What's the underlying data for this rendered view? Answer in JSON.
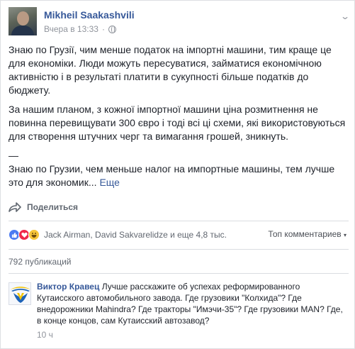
{
  "post": {
    "author": "Mikheil Saakashvili",
    "timestamp": "Вчера в 13:33",
    "separator": "·",
    "paragraphs": [
      "Знаю по Грузії, чим менше податок на імпортні машини, тим краще це для економіки. Люди можуть пересуватися, займатися економічною активністю і в результаті платити в сукупності більше податків до бюджету.",
      "За нашим планом, з кожної імпортної машини ціна розмитнення не повинна перевищувати 300 євро і тоді всі ці схеми, які використовуються для створення штучних черг та вимагання грошей, зникнуть.",
      "—",
      "Знаю по Грузии, чем меньше налог на импортные машины, тем лучше это для экономик..."
    ],
    "more_label": "Еще"
  },
  "actions": {
    "share_label": "Поделиться"
  },
  "reactions": {
    "summary": "Jack Airman, David Sakvarelidze и еще 4,8 тыс.",
    "top_comments_label": "Топ комментариев"
  },
  "shares": {
    "count_label": "792 публикаций"
  },
  "comment": {
    "author": "Виктор Кравец",
    "text": "Лучше расскажите об успехах реформированного Кутаисского автомобильного завода. Где грузовики \"Колхида\"? Где внедорожники Mahindra? Где тракторы \"Имэчи-35\"? Где грузовики MAN? Где, в конце концов, сам Кутаисский автозавод?",
    "time": "10 ч"
  },
  "colors": {
    "link": "#365899",
    "like": "#4b7bf1",
    "love": "#f0284a",
    "haha": "#f7c53a"
  },
  "icons": {
    "privacy": "globe-icon",
    "options": "chevron-down-icon",
    "share": "share-arrow-icon"
  }
}
